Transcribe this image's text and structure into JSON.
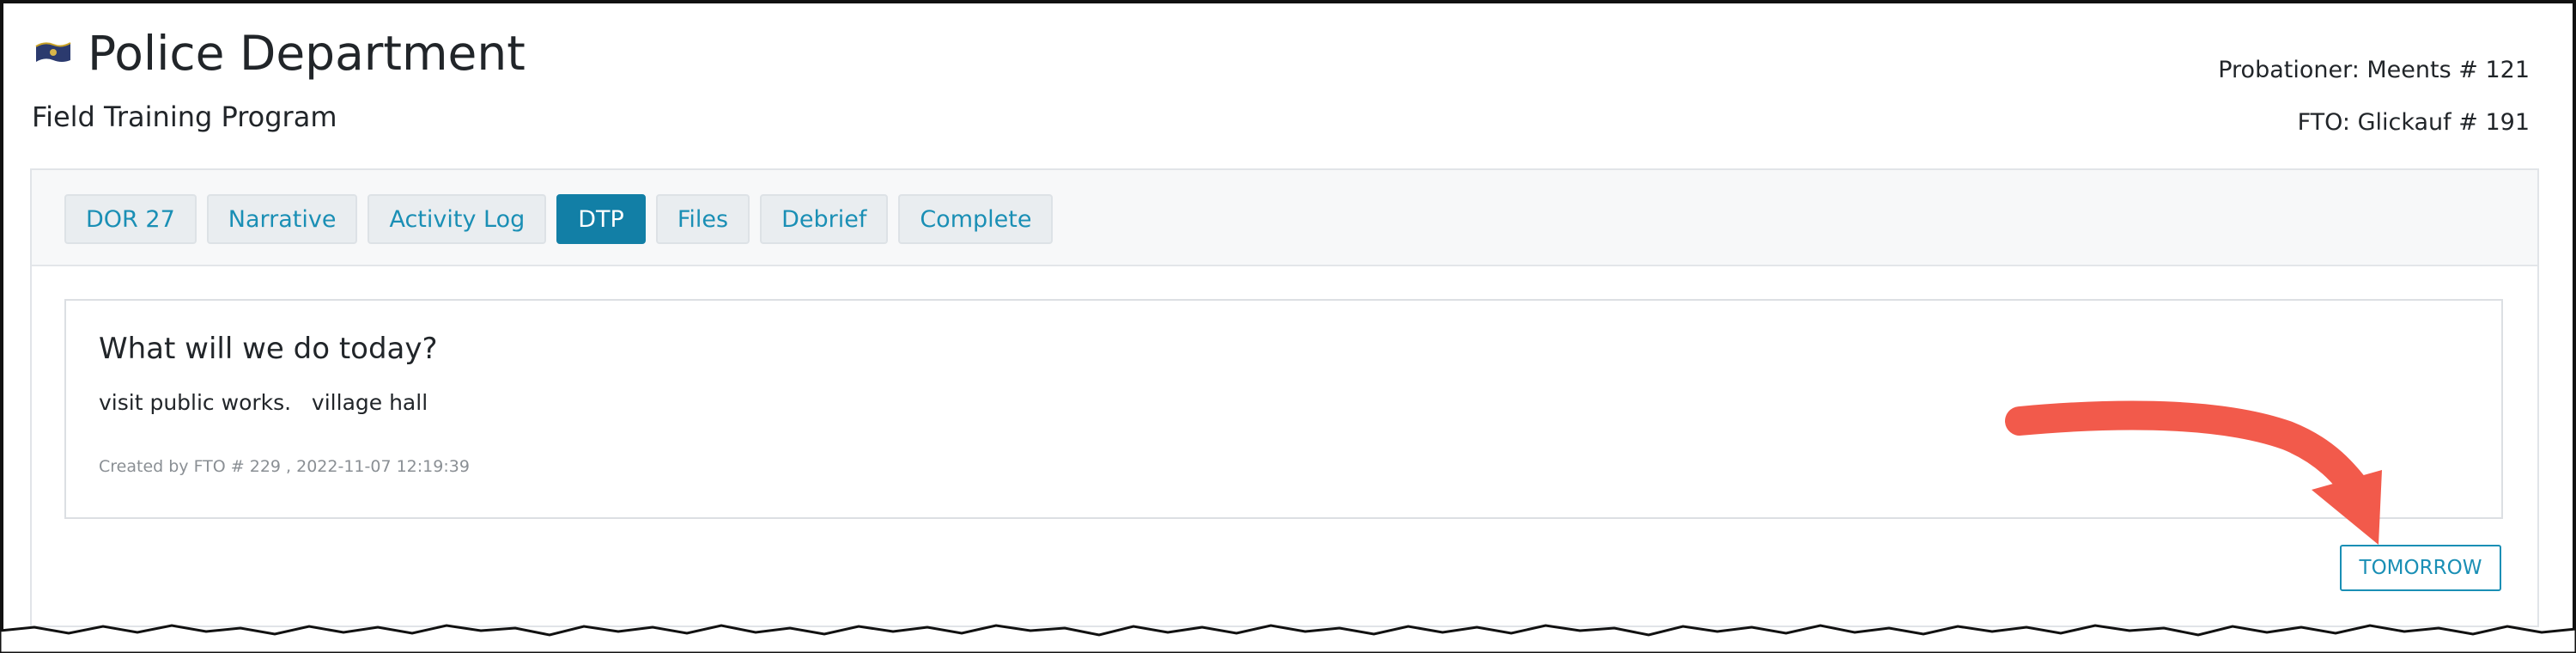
{
  "header": {
    "icon": "flag-icon",
    "title": "Police Department",
    "subtitle": "Field Training Program",
    "probationer": "Probationer: Meents # 121",
    "fto": "FTO: Glickauf # 191"
  },
  "tabs": [
    {
      "label": "DOR 27",
      "active": false
    },
    {
      "label": "Narrative",
      "active": false
    },
    {
      "label": "Activity Log",
      "active": false
    },
    {
      "label": "DTP",
      "active": true
    },
    {
      "label": "Files",
      "active": false
    },
    {
      "label": "Debrief",
      "active": false
    },
    {
      "label": "Complete",
      "active": false
    }
  ],
  "plan": {
    "question": "What will we do today?",
    "body": "visit public works.   village hall",
    "created": "Created by FTO # 229 , 2022-11-07 12:19:39"
  },
  "actions": {
    "tomorrow_label": "TOMORROW"
  },
  "colors": {
    "accent": "#127fa6",
    "tab_text": "#1a8fb5",
    "annotation_arrow": "#f25a4b"
  }
}
